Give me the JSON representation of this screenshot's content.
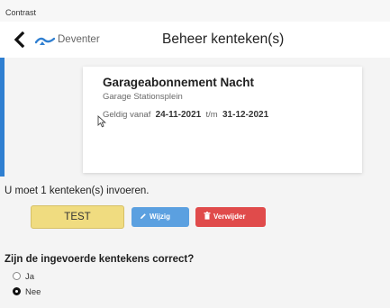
{
  "app": {
    "title": "Contrast"
  },
  "header": {
    "location": "Deventer",
    "title": "Beheer kenteken(s)"
  },
  "subscription": {
    "title": "Garageabonnement Nacht",
    "garage": "Garage Stationsplein",
    "valid_from_label": "Geldig vanaf",
    "valid_from": "24-11-2021",
    "until_label": "t/m",
    "valid_until": "31-12-2021"
  },
  "plates": {
    "instruction": "U moet 1 kenteken(s) invoeren.",
    "items": [
      {
        "plate": "TEST"
      }
    ],
    "edit_label": "Wijzig",
    "delete_label": "Verwijder"
  },
  "confirm": {
    "question": "Zijn de ingevoerde kentekens correct?",
    "options": [
      {
        "label": "Ja",
        "selected": false
      },
      {
        "label": "Nee",
        "selected": true
      }
    ]
  },
  "colors": {
    "accent": "#2f7fd1",
    "plate": "#f0dc80",
    "edit": "#5ba0e0",
    "delete": "#e04b4b"
  }
}
